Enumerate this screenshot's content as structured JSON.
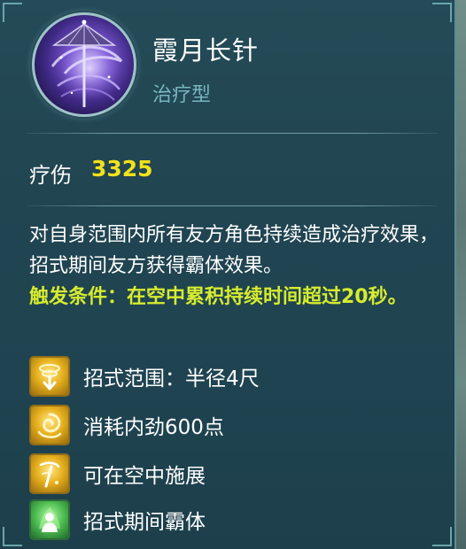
{
  "skill": {
    "name": "霞月长针",
    "type": "治疗型",
    "icon": "parasol-spiral-icon"
  },
  "stat": {
    "label": "疗伤",
    "value": "3325"
  },
  "description": {
    "main": "对自身范围内所有友方角色持续造成治疗效果，招式期间友方获得霸体效果。",
    "trigger": "触发条件：在空中累积持续时间超过20秒。"
  },
  "properties": [
    {
      "icon": "range-arrow-icon",
      "label": "招式范围：半径4尺"
    },
    {
      "icon": "swirl-energy-icon",
      "label": "消耗内劲600点"
    },
    {
      "icon": "airborne-cast-icon",
      "label": "可在空中施展"
    },
    {
      "icon": "green-figure-icon",
      "label": "招式期间霸体"
    }
  ],
  "colors": {
    "panel_bg": "#214551",
    "accent_gold": "#f2e21b",
    "trigger_yellow": "#d6ec2e",
    "type_teal": "#79b6bc"
  }
}
